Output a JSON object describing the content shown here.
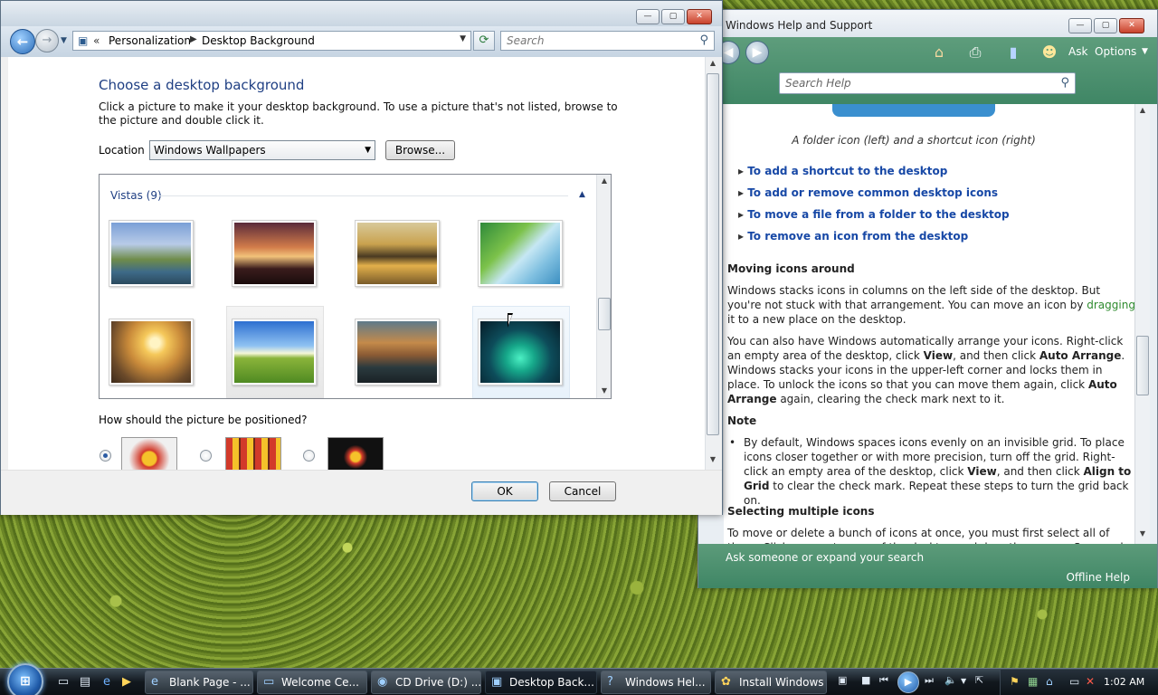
{
  "help": {
    "title": "Windows Help and Support",
    "toolbar": {
      "ask": "Ask",
      "options": "Options"
    },
    "search_placeholder": "Search Help",
    "caption": "A folder icon (left) and a shortcut icon (right)",
    "links": [
      "To add a shortcut to the desktop",
      "To add or remove common desktop icons",
      "To move a file from a folder to the desktop",
      "To remove an icon from the desktop"
    ],
    "section1_heading": "Moving icons around",
    "p1_a": "Windows stacks icons in columns on the left side of the desktop. But you're not stuck with that arrangement. You can move an icon by ",
    "p1_link": "dragging",
    "p1_b": " it to a new place on the desktop.",
    "p2_a": "You can also have Windows automatically arrange your icons. Right-click an empty area of the desktop, click ",
    "p2_b1": "View",
    "p2_c": ", and then click ",
    "p2_b2": "Auto Arrange",
    "p2_d": ". Windows stacks your icons in the upper-left corner and locks them in place. To unlock the icons so that you can move them again, click ",
    "p2_b3": "Auto Arrange",
    "p2_e": " again, clearing the check mark next to it.",
    "note_heading": "Note",
    "note_a": "By default, Windows spaces icons evenly on an invisible grid. To place icons closer together or with more precision, turn off the grid. Right-click an empty area of the desktop, click ",
    "note_b1": "View",
    "note_c": ", and then click ",
    "note_b2": "Align to Grid",
    "note_d": " to clear the check mark. Repeat these steps to turn the grid back on.",
    "section2_heading": "Selecting multiple icons",
    "p3": "To move or delete a bunch of icons at once, you must first select all of them. Click an empty area of the desktop and drag the mouse. Surround the icons that you",
    "footer_ask": "Ask someone or expand your search",
    "footer_offline": "Offline Help"
  },
  "bg": {
    "address": {
      "crumb1": "Personalization",
      "crumb2": "Desktop Background",
      "search_placeholder": "Search"
    },
    "heading": "Choose a desktop background",
    "description": "Click a picture to make it your desktop background. To use a picture that's not listed, browse to the picture and double click it.",
    "location_label": "Location",
    "location_value": "Windows Wallpapers",
    "browse_label": "Browse...",
    "group_label": "Vistas (9)",
    "position_label": "How should the picture be positioned?",
    "ok_label": "OK",
    "cancel_label": "Cancel"
  },
  "taskbar": {
    "tasks": [
      "Blank Page - ...",
      "Welcome Ce...",
      "CD Drive (D:) ...",
      "Desktop Back...",
      "Windows Hel...",
      "Install Windows"
    ],
    "clock": "1:02 AM"
  },
  "colors": {
    "link": "#1748a6",
    "heading_blue": "#1f3f83",
    "help_green": "#3f8665"
  }
}
